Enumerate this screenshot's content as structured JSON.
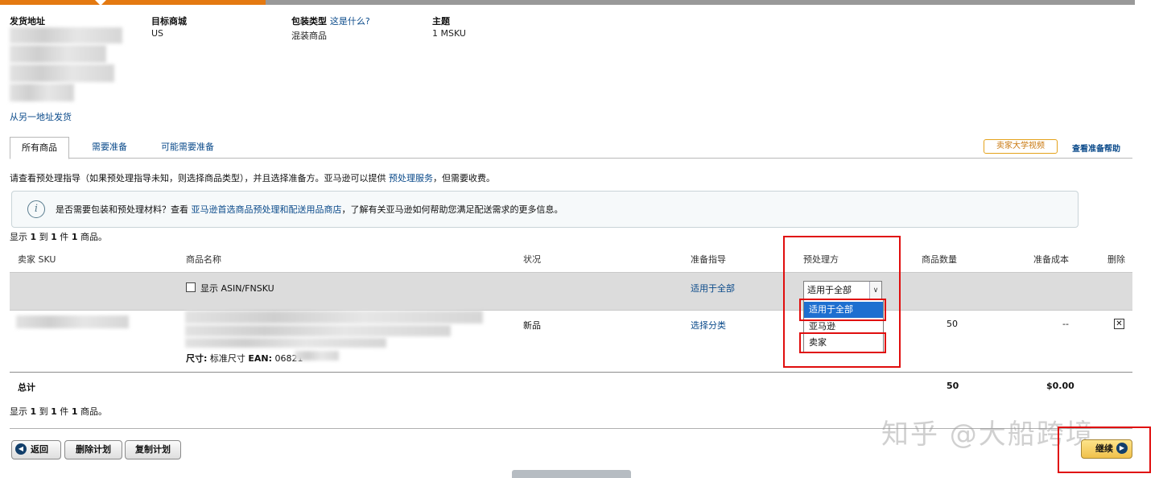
{
  "header": {
    "ship_from_label": "发货地址",
    "destination_label": "目标商城",
    "destination_value": "US",
    "packing_label": "包装类型",
    "packing_help_link": "这是什么?",
    "packing_value": "混装商品",
    "subject_label": "主题",
    "subject_value": "1 MSKU",
    "ship_other_link": "从另一地址发货"
  },
  "tabs": {
    "all": "所有商品",
    "needs_prep": "需要准备",
    "may_need_prep": "可能需要准备"
  },
  "actions": {
    "video_button": "卖家大学视频",
    "prep_help_link": "查看准备帮助"
  },
  "instructions": {
    "text_before": "请查看预处理指导（如果预处理指导未知，则选择商品类型），并且选择准备方。亚马逊可以提供 ",
    "link": "预处理服务",
    "text_after": "，但需要收费。"
  },
  "notice": {
    "icon": "info-icon",
    "text_before": "是否需要包装和预处理材料？查看 ",
    "link": "亚马逊首选商品预处理和配送用品商店",
    "text_after": "，了解有关亚马逊如何帮助您满足配送需求的更多信息。"
  },
  "pagination_top": {
    "pre": "显示 ",
    "from": "1",
    "mid1": " 到 ",
    "to": "1",
    "mid2": " 件 ",
    "total": "1",
    "post": " 商品。"
  },
  "pagination_bottom": {
    "pre": "显示 ",
    "from": "1",
    "mid1": " 到 ",
    "to": "1",
    "mid2": " 件 ",
    "total": "1",
    "post": " 商品。"
  },
  "table": {
    "headers": {
      "sku": "卖家 SKU",
      "name": "商品名称",
      "condition": "状况",
      "prep_guide": "准备指导",
      "prep_owner": "预处理方",
      "quantity": "商品数量",
      "prep_cost": "准备成本",
      "delete": "删除"
    },
    "apply_all_row": {
      "show_asin_label": "显示 ASIN/FNSKU",
      "prep_guide_link": "适用于全部",
      "select_value": "适用于全部"
    },
    "dropdown_options": [
      "适用于全部",
      "亚马逊",
      "卖家"
    ],
    "item": {
      "condition": "新品",
      "prep_guide_link": "选择分类",
      "size_label": "尺寸:",
      "size_value": "标准尺寸",
      "ean_label": "EAN:",
      "ean_value": "06821",
      "quantity": "50",
      "prep_cost": "--",
      "delete_glyph": "✕"
    },
    "total": {
      "label": "总计",
      "quantity": "50",
      "cost": "$0.00"
    }
  },
  "buttons": {
    "back": "返回",
    "delete_plan": "删除计划",
    "copy_plan": "复制计划",
    "continue": "继续",
    "arrow_left": "◀",
    "arrow_right": "▶"
  },
  "watermark": "知乎 @大船跨境",
  "colors": {
    "accent_orange": "#e47911",
    "link_blue": "#0a4a8a",
    "highlight_red": "#e00e0e",
    "select_blue": "#1e6fd0"
  }
}
